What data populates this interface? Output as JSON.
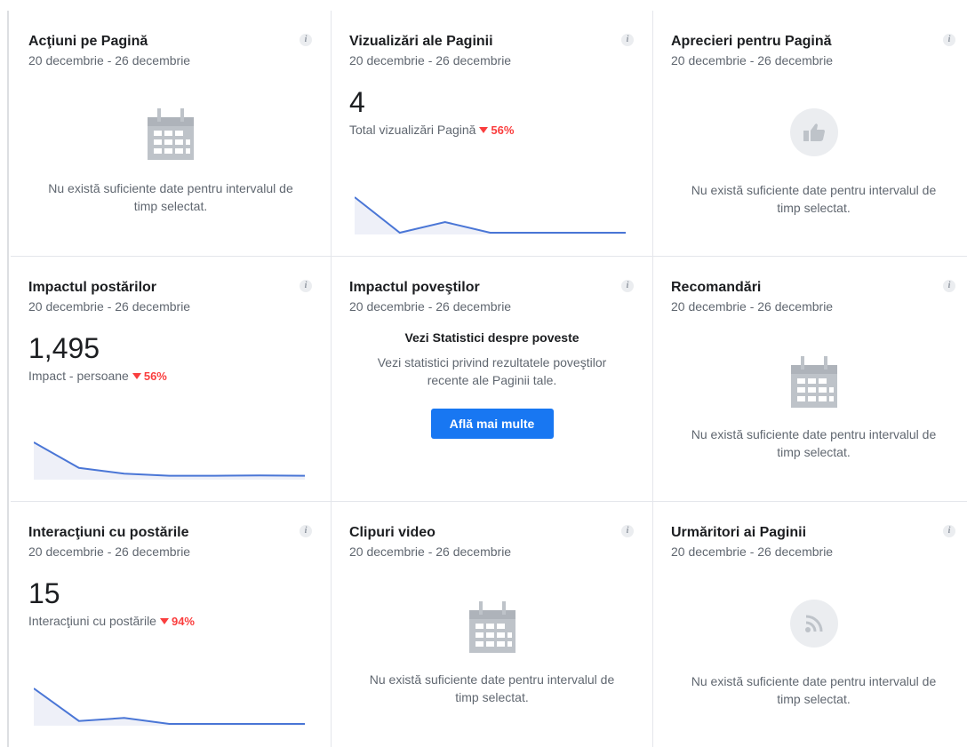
{
  "cards": [
    {
      "title": "Acţiuni pe Pagină",
      "date": "20 decembrie - 26 decembrie",
      "empty_text": "Nu există suficiente date pentru intervalul de timp selectat.",
      "icon": "calendar-icon"
    },
    {
      "title": "Vizualizări ale Paginii",
      "date": "20 decembrie - 26 decembrie",
      "value": "4",
      "metric_label": "Total vizualizări Pagină",
      "delta": "56%",
      "delta_direction": "down",
      "trend": [
        5,
        0,
        1.5,
        0,
        0,
        0,
        0
      ]
    },
    {
      "title": "Aprecieri pentru Pagină",
      "date": "20 decembrie - 26 decembrie",
      "empty_text": "Nu există suficiente date pentru intervalul de timp selectat.",
      "icon": "thumbs-up-icon"
    },
    {
      "title": "Impactul postărilor",
      "date": "20 decembrie - 26 decembrie",
      "value": "1,495",
      "metric_label": "Impact - persoane",
      "delta": "56%",
      "delta_direction": "down",
      "trend": [
        1000,
        280,
        120,
        60,
        60,
        70,
        60
      ]
    },
    {
      "title": "Impactul poveştilor",
      "date": "20 decembrie - 26 decembrie",
      "story_heading": "Vezi Statistici despre poveste",
      "story_text": "Vezi statistici privind rezultatele poveştilor recente ale Paginii tale.",
      "button_label": "Află mai multe"
    },
    {
      "title": "Recomandări",
      "date": "20 decembrie - 26 decembrie",
      "empty_text": "Nu există suficiente date pentru intervalul de timp selectat.",
      "icon": "calendar-icon"
    },
    {
      "title": "Interacţiuni cu postările",
      "date": "20 decembrie - 26 decembrie",
      "value": "15",
      "metric_label": "Interacţiuni cu postările",
      "delta": "94%",
      "delta_direction": "down",
      "trend": [
        12,
        1,
        2,
        0,
        0,
        0,
        0
      ]
    },
    {
      "title": "Clipuri video",
      "date": "20 decembrie - 26 decembrie",
      "empty_text": "Nu există suficiente date pentru intervalul de timp selectat.",
      "icon": "calendar-icon"
    },
    {
      "title": "Urmăritori ai Paginii",
      "date": "20 decembrie - 26 decembrie",
      "empty_text": "Nu există suficiente date pentru intervalul de timp selectat.",
      "icon": "rss-feed-icon"
    }
  ],
  "info_glyph": "i",
  "colors": {
    "accent": "#1877f2",
    "trend_line": "#4a76d6",
    "trend_fill": "#eef0f8",
    "negative": "#fa3e3e",
    "empty_icon": "#bec3c9"
  }
}
